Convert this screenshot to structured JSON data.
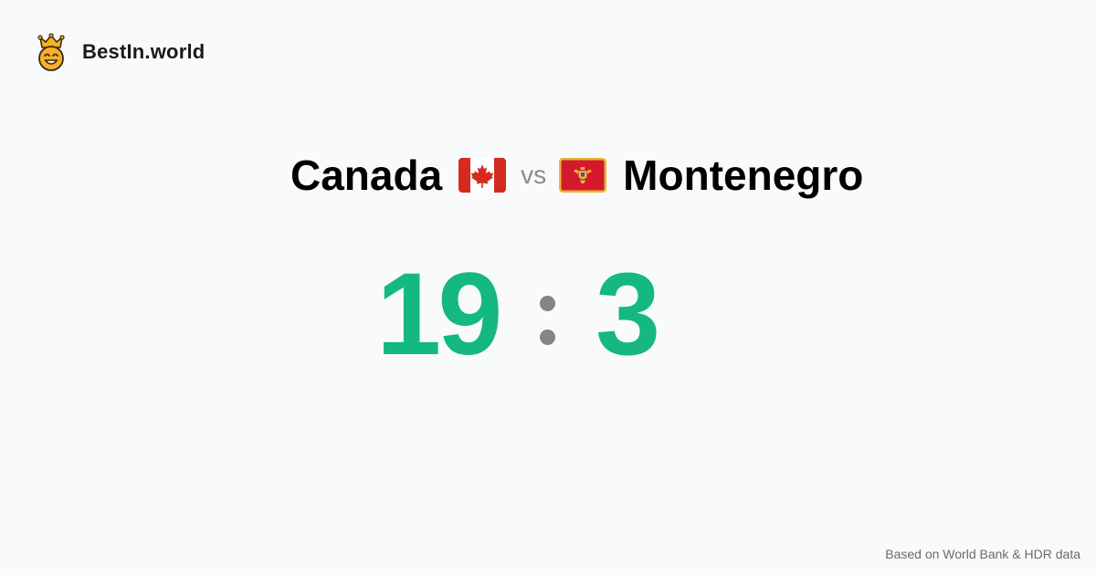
{
  "brand": {
    "name": "BestIn.world",
    "logo_icon": "smiling-crown-face-icon"
  },
  "comparison": {
    "left_country": "Canada",
    "left_flag_icon": "canada-flag-icon",
    "vs_label": "vs",
    "right_country": "Montenegro",
    "right_flag_icon": "montenegro-flag-icon"
  },
  "score": {
    "left": "19",
    "right": "3"
  },
  "footer": {
    "source": "Based on World Bank & HDR data"
  },
  "colors": {
    "background": "#f8fafc",
    "score": "#14b880",
    "separator": "#858585",
    "muted_text": "#8a8a8a",
    "canada_red": "#d52b1e",
    "montenegro_red": "#d3192c",
    "montenegro_gold": "#e8b535"
  }
}
